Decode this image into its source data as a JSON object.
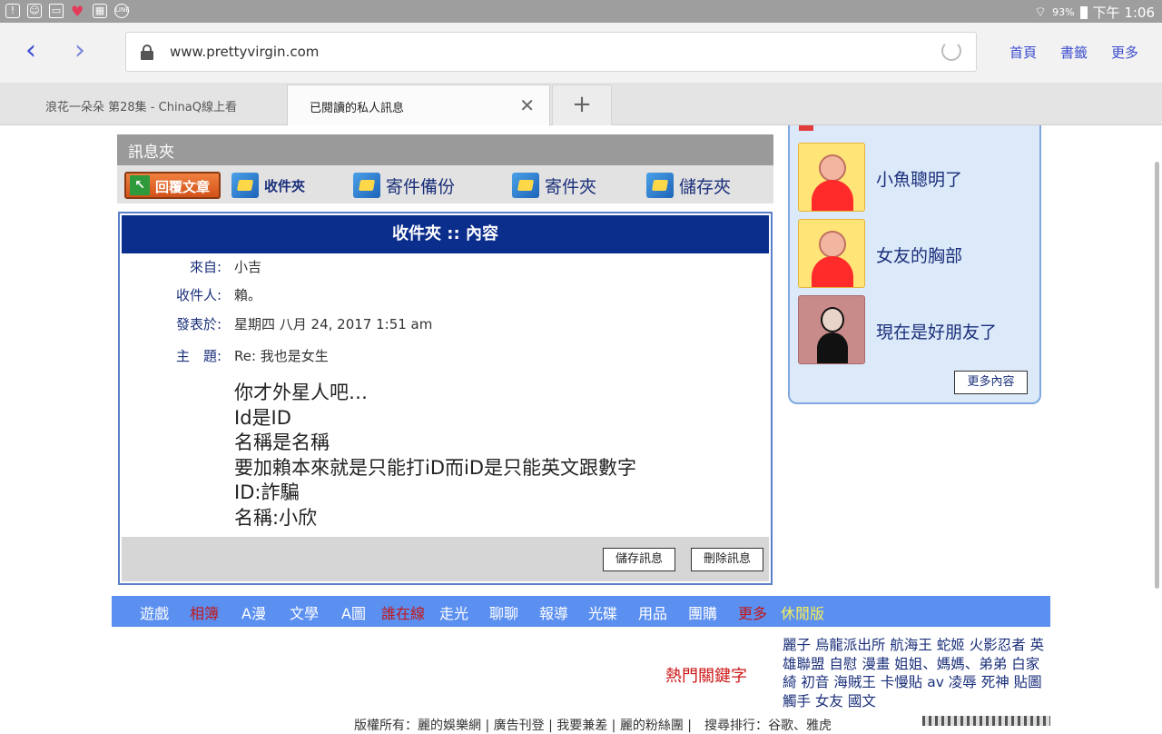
{
  "status_bar": {
    "battery": "93%",
    "time": "下午 1:06"
  },
  "browser": {
    "url": "www.prettyvirgin.com",
    "toolbar_links": [
      "首頁",
      "書籤",
      "更多"
    ],
    "tabs": [
      {
        "title": "浪花一朵朵 第28集 - ChinaQ線上看"
      },
      {
        "title": "已閱讀的私人訊息"
      },
      {
        "title": "+"
      }
    ]
  },
  "page": {
    "folder_header": "訊息夾",
    "post_button": "回覆文章",
    "folders": [
      "收件夾",
      "寄件備份",
      "寄件夾",
      "儲存夾"
    ],
    "panel_title": "收件夾 :: 內容",
    "meta": {
      "from_label": "來自:",
      "from_value": "小吉",
      "to_label": "收件人:",
      "to_value": "賴。",
      "date_label": "發表於:",
      "date_value": "星期四 八月 24, 2017 1:51 am",
      "subject_label": "主　題:",
      "subject_value": "Re: 我也是女生"
    },
    "body_lines": [
      "你才外星人吧…",
      "Id是ID",
      "名稱是名稱",
      "要加賴本來就是只能打iD而iD是只能英文跟數字",
      "ID:詐騙",
      "名稱:小欣"
    ],
    "save_button": "儲存訊息",
    "delete_button": "刪除訊息"
  },
  "sidebar": {
    "items": [
      {
        "label": "小魚聰明了"
      },
      {
        "label": "女友的胸部"
      },
      {
        "label": "現在是好朋友了"
      }
    ],
    "more_button": "更多內容"
  },
  "bottom_nav": [
    {
      "label": "遊戲",
      "color": "white"
    },
    {
      "label": "相簿",
      "color": "red"
    },
    {
      "label": "A漫",
      "color": "white"
    },
    {
      "label": "文學",
      "color": "white"
    },
    {
      "label": "A圖",
      "color": "white"
    },
    {
      "label": "誰在線",
      "color": "red"
    },
    {
      "label": "走光",
      "color": "white"
    },
    {
      "label": "聊聊",
      "color": "white"
    },
    {
      "label": "報導",
      "color": "white"
    },
    {
      "label": "光碟",
      "color": "white"
    },
    {
      "label": "用品",
      "color": "white"
    },
    {
      "label": "團購",
      "color": "white"
    },
    {
      "label": "更多",
      "color": "red"
    },
    {
      "label": "休閒版",
      "color": "yellow"
    }
  ],
  "keywords": {
    "title": "熱門關鍵字",
    "list": "麗子 烏龍派出所 航海王 蛇姬 火影忍者 英雄聯盟 自慰 漫畫 姐姐、媽媽、弟弟 白家綺 初音 海賊王 卡慢貼 av 凌辱 死神 貼圖 觸手 女友 國文"
  },
  "footer": "版權所有：麗的娛樂網 | 廣告刊登 | 我要兼差 | 麗的粉絲團 |　搜尋排行：谷歌、雅虎"
}
